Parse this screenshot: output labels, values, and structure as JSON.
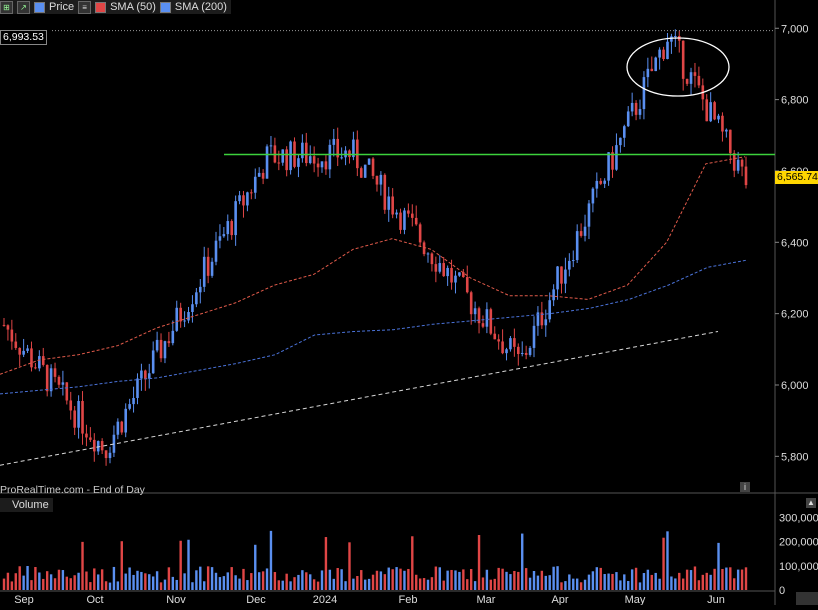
{
  "legend": {
    "price_label": "Price",
    "sma50_label": "SMA (50)",
    "sma200_label": "SMA (200)",
    "volume_label": "Volume"
  },
  "watermark": "ProRealTime.com - End of Day",
  "tags": {
    "high_value": "6,993.53",
    "last_value": "6,565.74"
  },
  "colors": {
    "up": "#5a8ff0",
    "down": "#e04646",
    "sma50": "#e05a4a",
    "sma200": "#4a72d8",
    "resistance": "#3cd23c",
    "trend": "#d8d8d8",
    "grid": "#3a3a3a"
  },
  "chart_data": {
    "type": "candlestick",
    "x_labels": [
      "Sep",
      "Oct",
      "Nov",
      "Dec",
      "2024",
      "Feb",
      "Mar",
      "Apr",
      "May",
      "Jun"
    ],
    "y_ticks": [
      "5,800",
      "6,000",
      "6,200",
      "6,400",
      "6,600",
      "6,800",
      "7,000"
    ],
    "y_range": [
      5700,
      7040
    ],
    "volume_ticks": [
      "0",
      "100,000",
      "200,000",
      "300,000"
    ],
    "volume_range": [
      0,
      330000
    ],
    "high_line": 6993.53,
    "last_price": 6565.74,
    "resistance_level": 6646,
    "key_points": [
      {
        "month": "Sep",
        "price": 6120
      },
      {
        "month": "Oct",
        "price": 5820
      },
      {
        "month": "Dec",
        "price": 6640
      },
      {
        "month": "2024",
        "price": 6650
      },
      {
        "month": "Mar",
        "price": 6060
      },
      {
        "month": "May",
        "price": 6980
      },
      {
        "month": "Jun",
        "price": 6565.74
      }
    ],
    "sma50": [
      6030,
      6070,
      6085,
      6110,
      6160,
      6195,
      6230,
      6280,
      6310,
      6380,
      6410,
      6380,
      6300,
      6250,
      6250,
      6240,
      6280,
      6400,
      6620,
      6640
    ],
    "sma200": [
      5975,
      5985,
      5995,
      6010,
      6020,
      6040,
      6060,
      6085,
      6140,
      6150,
      6155,
      6170,
      6180,
      6190,
      6200,
      6215,
      6240,
      6280,
      6330,
      6350
    ],
    "trendline": [
      {
        "x": "start",
        "y": 5775
      },
      {
        "x": "Jun",
        "y": 6150
      }
    ],
    "series": [
      {
        "name": "SMA (50)"
      },
      {
        "name": "SMA (200)"
      },
      {
        "name": "Volume"
      }
    ]
  }
}
